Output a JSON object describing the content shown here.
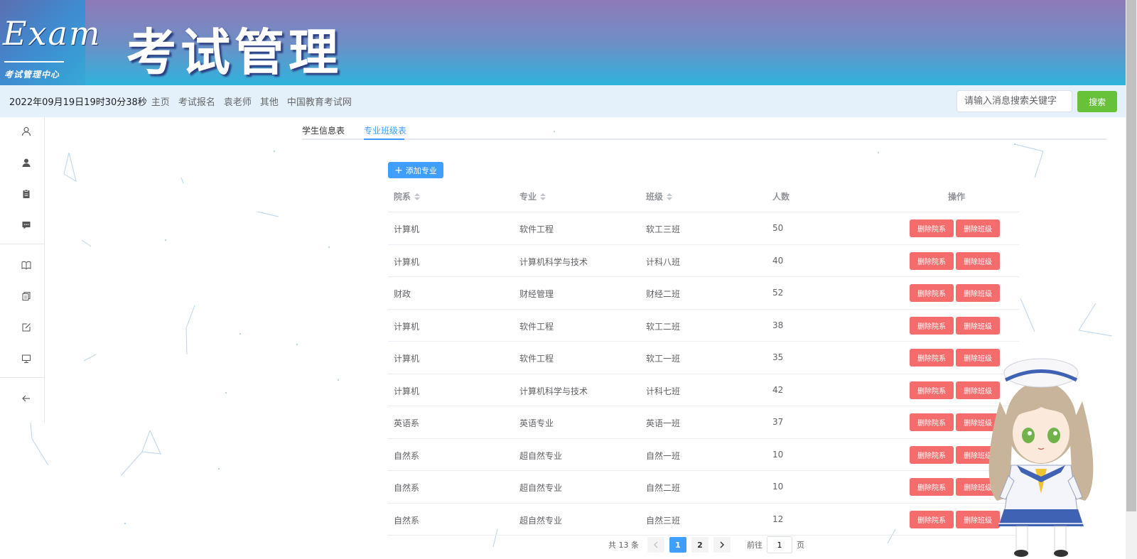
{
  "banner": {
    "logo_text": "Exam",
    "logo_sub": "考试管理中心",
    "title": "考试管理"
  },
  "nav": {
    "clock": "2022年09月19日19时30分38秒",
    "links": [
      "主页",
      "考试报名",
      "袁老师",
      "其他",
      "中国教育考试网"
    ],
    "search_placeholder": "请输入消息搜索关键字",
    "search_button": "搜索"
  },
  "sidebar": {
    "icons": [
      "user-outline-icon",
      "user-solid-icon",
      "clipboard-icon",
      "chat-icon",
      "book-icon",
      "copy-icon",
      "edit-icon",
      "monitor-icon",
      "back-arrow-icon"
    ]
  },
  "tabs": [
    {
      "label": "学生信息表",
      "active": false
    },
    {
      "label": "专业班级表",
      "active": true
    }
  ],
  "add_button": "添加专业",
  "table": {
    "headers": [
      "院系",
      "专业",
      "班级",
      "人数",
      "操作"
    ],
    "rows": [
      {
        "dept": "计算机",
        "major": "软件工程",
        "cls": "软工三班",
        "count": "50"
      },
      {
        "dept": "计算机",
        "major": "计算机科学与技术",
        "cls": "计科八班",
        "count": "40"
      },
      {
        "dept": "财政",
        "major": "财经管理",
        "cls": "财经二班",
        "count": "52"
      },
      {
        "dept": "计算机",
        "major": "软件工程",
        "cls": "软工二班",
        "count": "38"
      },
      {
        "dept": "计算机",
        "major": "软件工程",
        "cls": "软工一班",
        "count": "35"
      },
      {
        "dept": "计算机",
        "major": "计算机科学与技术",
        "cls": "计科七班",
        "count": "42"
      },
      {
        "dept": "英语系",
        "major": "英语专业",
        "cls": "英语一班",
        "count": "37"
      },
      {
        "dept": "自然系",
        "major": "超自然专业",
        "cls": "自然一班",
        "count": "10"
      },
      {
        "dept": "自然系",
        "major": "超自然专业",
        "cls": "自然二班",
        "count": "10"
      },
      {
        "dept": "自然系",
        "major": "超自然专业",
        "cls": "自然三班",
        "count": "12"
      }
    ],
    "delete_dept_label": "删除院系",
    "delete_class_label": "删除班级"
  },
  "pagination": {
    "total": "共 13 条",
    "pages": [
      "1",
      "2"
    ],
    "current": "1",
    "goto_prefix": "前往",
    "goto_value": "1",
    "goto_suffix": "页"
  },
  "colors": {
    "primary": "#409eff",
    "danger": "#f56c6c",
    "success": "#67c23a",
    "navbar_bg": "#e4f1fb"
  }
}
